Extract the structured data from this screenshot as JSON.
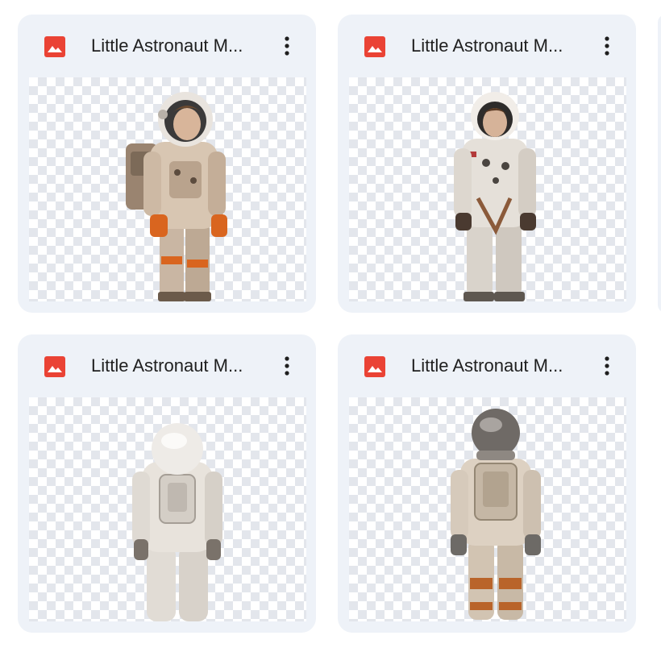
{
  "files": [
    {
      "name": "Little Astronaut M...",
      "file_type_icon": "image-file-icon",
      "menu_icon": "more-vert-icon",
      "preview": "child astronaut with orange gloves, side view"
    },
    {
      "name": "Little Astronaut M...",
      "file_type_icon": "image-file-icon",
      "menu_icon": "more-vert-icon",
      "preview": "child astronaut in white suit, front view"
    },
    {
      "name": "Little Astronaut M...",
      "file_type_icon": "image-file-icon",
      "menu_icon": "more-vert-icon",
      "preview": "astronaut in white suit, back view"
    },
    {
      "name": "Little Astronaut M...",
      "file_type_icon": "image-file-icon",
      "menu_icon": "more-vert-icon",
      "preview": "astronaut with backpack and orange bands, back view"
    }
  ],
  "colors": {
    "card_bg": "#eef2f8",
    "icon_red": "#ea4335",
    "title_text": "#1f1f1f",
    "checker": "#e3e6ec"
  }
}
